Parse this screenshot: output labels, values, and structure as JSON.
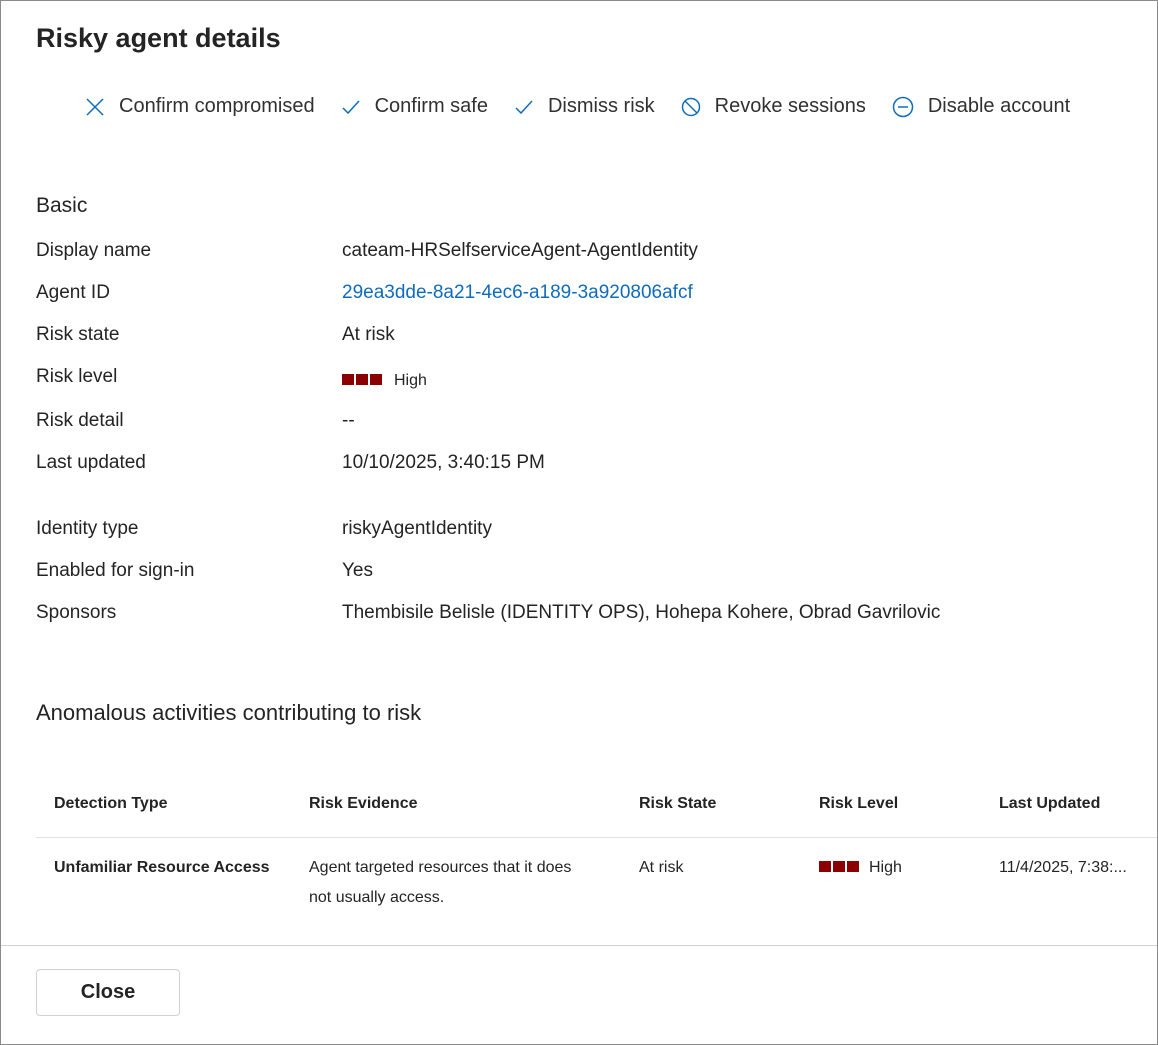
{
  "title": "Risky agent details",
  "toolbar": [
    {
      "label": "Confirm compromised",
      "icon": "x-icon"
    },
    {
      "label": "Confirm safe",
      "icon": "check-icon"
    },
    {
      "label": "Dismiss risk",
      "icon": "check-icon"
    },
    {
      "label": "Revoke sessions",
      "icon": "block-icon"
    },
    {
      "label": "Disable account",
      "icon": "minus-circle-icon"
    }
  ],
  "basic": {
    "heading": "Basic",
    "display_name": {
      "label": "Display name",
      "value": "cateam-HRSelfserviceAgent-AgentIdentity"
    },
    "agent_id": {
      "label": "Agent ID",
      "value": "29ea3dde-8a21-4ec6-a189-3a920806afcf"
    },
    "risk_state": {
      "label": "Risk state",
      "value": "At risk"
    },
    "risk_level": {
      "label": "Risk level",
      "value": "High"
    },
    "risk_detail": {
      "label": "Risk detail",
      "value": "--"
    },
    "last_updated": {
      "label": "Last updated",
      "value": "10/10/2025, 3:40:15 PM"
    },
    "identity_type": {
      "label": "Identity type",
      "value": "riskyAgentIdentity"
    },
    "enabled": {
      "label": "Enabled for sign-in",
      "value": "Yes"
    },
    "sponsors": {
      "label": "Sponsors",
      "value": "Thembisile Belisle (IDENTITY OPS), Hohepa Kohere, Obrad Gavrilovic"
    }
  },
  "anomalous": {
    "heading": "Anomalous activities contributing to risk",
    "columns": [
      "Detection Type",
      "Risk Evidence",
      "Risk State",
      "Risk Level",
      "Last Updated"
    ],
    "rows": [
      {
        "detection": "Unfamiliar Resource Access",
        "evidence_line1": "Agent targeted resources that it does",
        "evidence_line2": "not usually access.",
        "state": "At risk",
        "level": "High",
        "updated": "11/4/2025, 7:38:..."
      }
    ]
  },
  "risk_color": "#8b0000",
  "close_label": "Close"
}
